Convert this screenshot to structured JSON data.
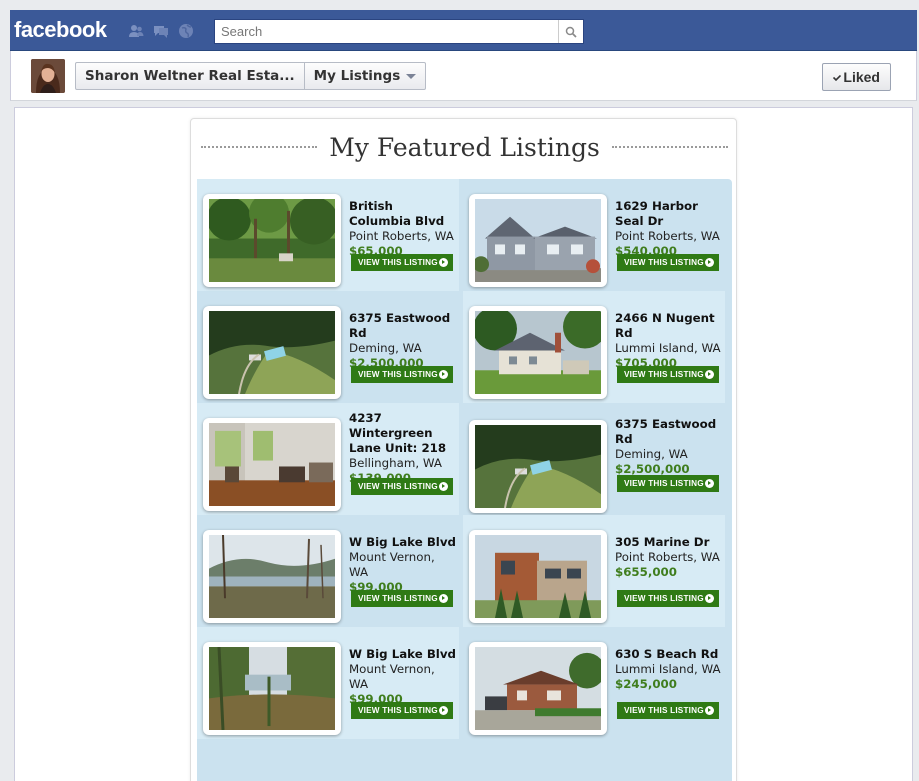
{
  "topbar": {
    "logo": "facebook",
    "search_placeholder": "Search",
    "icons": [
      "friend-requests-icon",
      "messages-icon",
      "notifications-globe-icon",
      "search-magnifier-icon"
    ]
  },
  "page_header": {
    "page_name": "Sharon Weltner Real Esta...",
    "tab_selector": "My Listings",
    "liked_button": "Liked"
  },
  "app": {
    "title": "My Featured Listings",
    "view_button_label": "VIEW THIS LISTING",
    "listings": [
      {
        "street": "British Columbia Blvd",
        "city": "Point Roberts, WA",
        "price": "$65,000",
        "photo": "forest"
      },
      {
        "street": "1629 Harbor Seal Dr",
        "city": "Point Roberts, WA",
        "price": "$540,000",
        "photo": "house-grey"
      },
      {
        "street": "6375 Eastwood Rd",
        "city": "Deming, WA",
        "price": "$2,500,000",
        "photo": "aerial"
      },
      {
        "street": "2466 N Nugent Rd",
        "city": "Lummi Island, WA",
        "price": "$705,000",
        "photo": "cottage"
      },
      {
        "street": "4237 Wintergreen Lane Unit: 218",
        "city": "Bellingham, WA",
        "price": "$139,000",
        "photo": "interior"
      },
      {
        "street": "6375 Eastwood Rd",
        "city": "Deming, WA",
        "price": "$2,500,000",
        "photo": "aerial"
      },
      {
        "street": "W Big Lake Blvd",
        "city": "Mount Vernon, WA",
        "price": "$99,000",
        "photo": "lake"
      },
      {
        "street": "305 Marine Dr",
        "city": "Point Roberts, WA",
        "price": "$655,000",
        "photo": "modern"
      },
      {
        "street": "W Big Lake Blvd",
        "city": "Mount Vernon, WA",
        "price": "$99,000",
        "photo": "lake-woods"
      },
      {
        "street": "630 S Beach Rd",
        "city": "Lummi Island, WA",
        "price": "$245,000",
        "photo": "brick-house"
      }
    ]
  }
}
